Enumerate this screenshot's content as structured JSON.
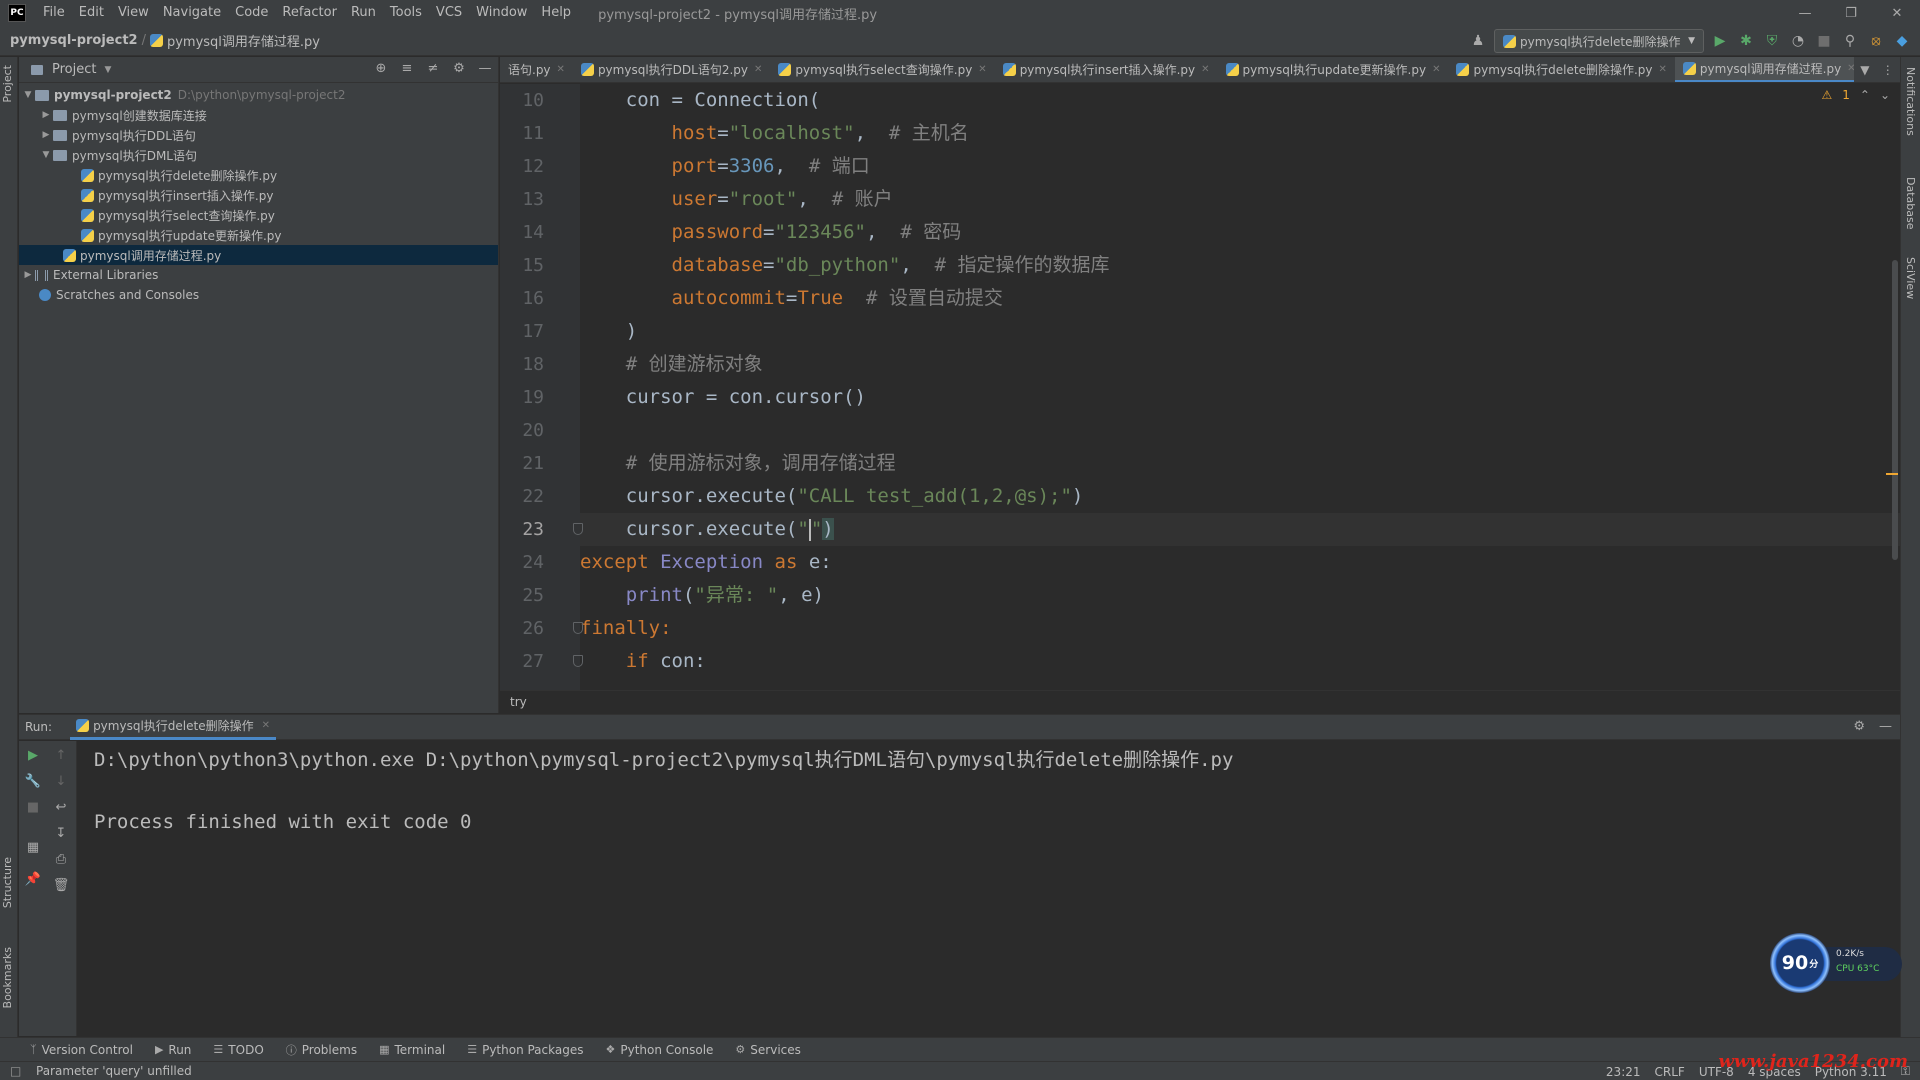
{
  "window": {
    "app_logo": "PC",
    "title": "pymysql-project2 - pymysql调用存储过程.py",
    "menu": [
      "File",
      "Edit",
      "View",
      "Navigate",
      "Code",
      "Refactor",
      "Run",
      "Tools",
      "VCS",
      "Window",
      "Help"
    ]
  },
  "navbar": {
    "project": "pymysql-project2",
    "file": "pymysql调用存储过程.py",
    "run_config": "pymysql执行delete删除操作"
  },
  "left_strip": {
    "project": "Project",
    "structure": "Structure",
    "bookmarks": "Bookmarks"
  },
  "right_strip": {
    "notifications": "Notifications",
    "database": "Database",
    "sciview": "SciView"
  },
  "project_panel": {
    "title": "Project",
    "root": {
      "name": "pymysql-project2",
      "path": "D:\\python\\pymysql-project2"
    },
    "folders": [
      "pymysql创建数据库连接",
      "pymysql执行DDL语句",
      "pymysql执行DML语句"
    ],
    "dml_files": [
      "pymysql执行delete删除操作.py",
      "pymysql执行insert插入操作.py",
      "pymysql执行select查询操作.py",
      "pymysql执行update更新操作.py"
    ],
    "selected_file": "pymysql调用存储过程.py",
    "external_libraries": "External Libraries",
    "scratches": "Scratches and Consoles"
  },
  "editor": {
    "tabs": [
      "语句.py",
      "pymysql执行DDL语句2.py",
      "pymysql执行select查询操作.py",
      "pymysql执行insert插入操作.py",
      "pymysql执行update更新操作.py",
      "pymysql执行delete删除操作.py",
      "pymysql调用存储过程.py"
    ],
    "active_tab": 6,
    "warning_count": "1",
    "line_numbers": [
      "10",
      "11",
      "12",
      "13",
      "14",
      "15",
      "16",
      "17",
      "18",
      "19",
      "20",
      "21",
      "22",
      "23",
      "24",
      "25",
      "26",
      "27"
    ],
    "current_line": "23",
    "breadcrumb": "try",
    "code": {
      "l10": "con = Connection(",
      "host_key": "host",
      "host_val": "\"localhost\"",
      "host_cmt": "# 主机名",
      "port_key": "port",
      "port_val": "3306",
      "port_cmt": "# 端口",
      "user_key": "user",
      "user_val": "\"root\"",
      "user_cmt": "# 账户",
      "pwd_key": "password",
      "pwd_val": "\"123456\"",
      "pwd_cmt": "# 密码",
      "db_key": "database",
      "db_val": "\"db_python\"",
      "db_cmt": "# 指定操作的数据库",
      "ac_key": "autocommit",
      "ac_val": "True",
      "ac_cmt": "# 设置自动提交",
      "l17": ")",
      "l18": "# 创建游标对象",
      "l19": "cursor = con.cursor()",
      "l21": "# 使用游标对象，调用存储过程",
      "l22_a": "cursor.execute(",
      "l22_str": "\"CALL test_add(1,2,@s);\"",
      "l22_b": ")",
      "l23_a": "cursor.execute(",
      "l23_q1": "\"",
      "l23_q2": "\"",
      "l23_b": ")",
      "l24_kw": "except",
      "l24_cls": "Exception",
      "l24_as": "as",
      "l24_rest": "e:",
      "l25_fn": "print",
      "l25_str": "\"异常: \"",
      "l25_rest": ", e)",
      "l26": "finally:",
      "l27_kw": "if",
      "l27_rest": "con:"
    }
  },
  "run_panel": {
    "label": "Run:",
    "tab": "pymysql执行delete删除操作",
    "output": [
      "D:\\python\\python3\\python.exe D:\\python\\pymysql-project2\\pymysql执行DML语句\\pymysql执行delete删除操作.py",
      "Process finished with exit code 0"
    ]
  },
  "widget": {
    "score": "90",
    "unit": "分",
    "speed": "0.2K/s",
    "cpu": "CPU 63°C"
  },
  "bottom_tools": [
    "Version Control",
    "Run",
    "TODO",
    "Problems",
    "Terminal",
    "Python Packages",
    "Python Console",
    "Services"
  ],
  "status": {
    "message": "Parameter 'query' unfilled",
    "position": "23:21",
    "line_sep": "CRLF",
    "encoding": "UTF-8",
    "indent": "4 spaces",
    "interpreter": "Python 3.11"
  },
  "watermark": "www.java1234.com"
}
